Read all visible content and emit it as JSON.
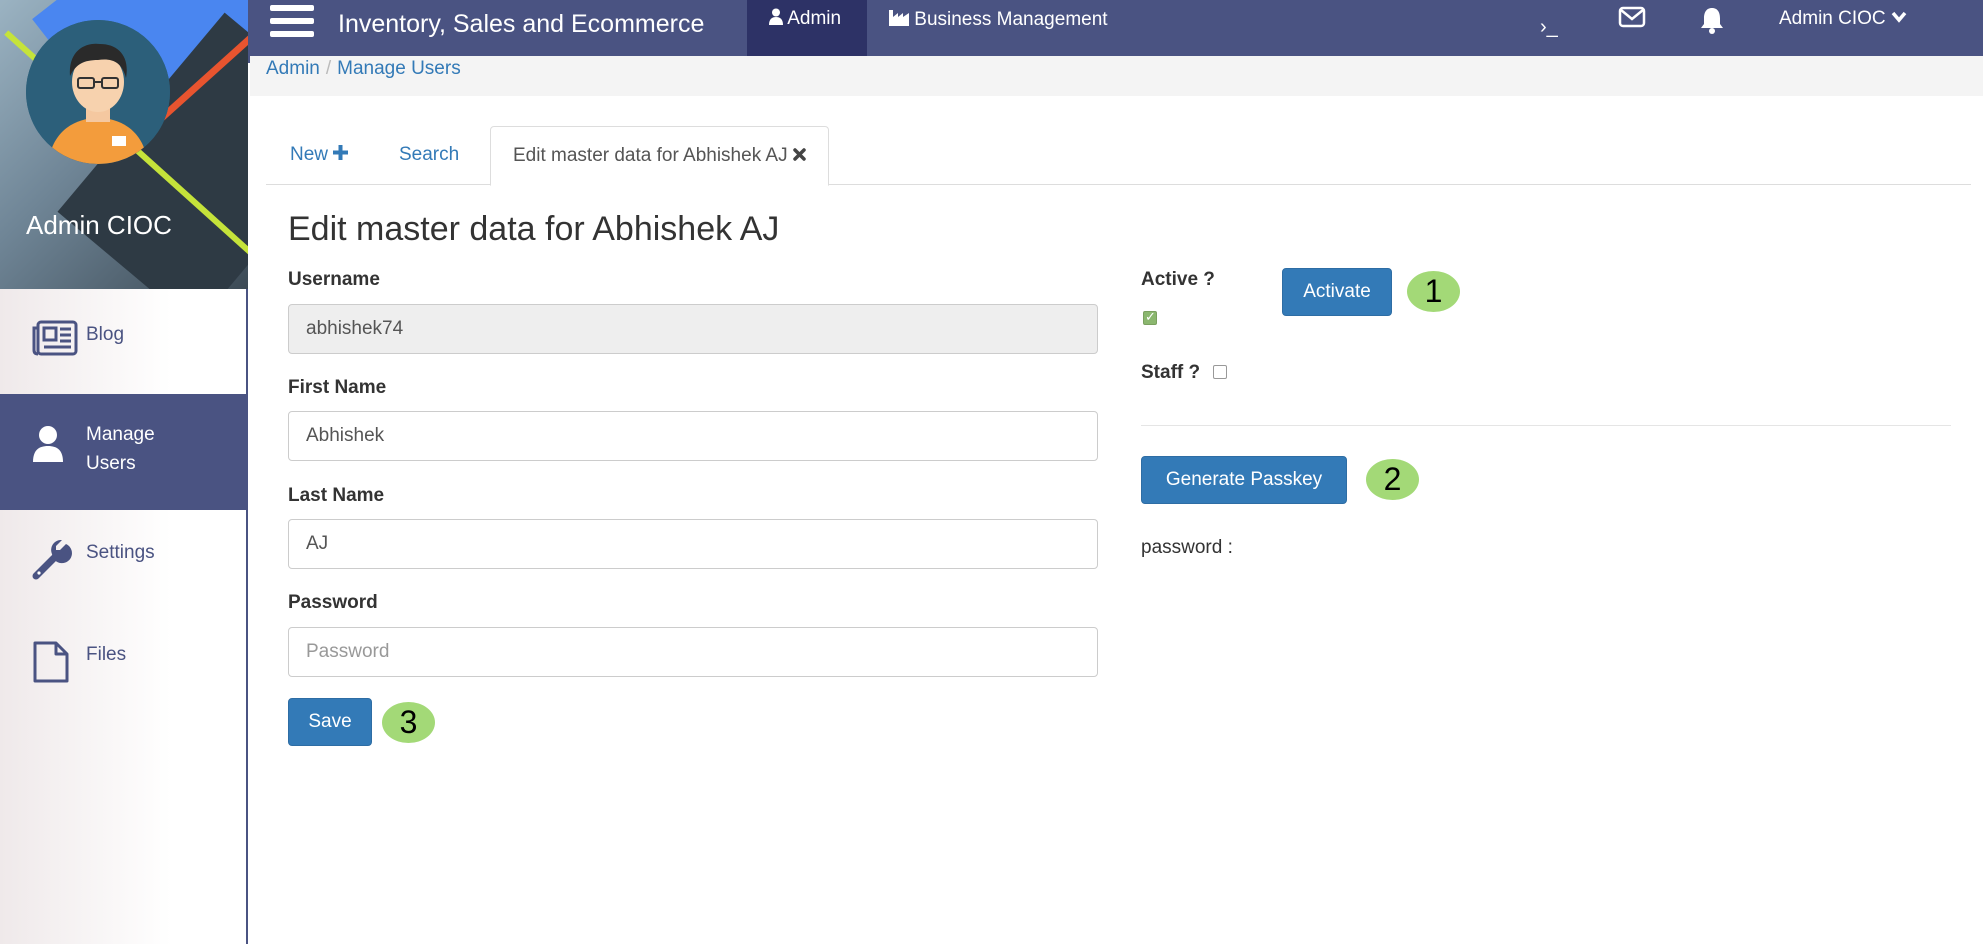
{
  "sidebar": {
    "profile_name": "Admin CIOC",
    "items": [
      {
        "label": "Blog",
        "icon": "newspaper-icon"
      },
      {
        "label": "Manage Users",
        "icon": "user-icon"
      },
      {
        "label": "Settings",
        "icon": "wrench-icon"
      },
      {
        "label": "Files",
        "icon": "file-icon"
      }
    ]
  },
  "topbar": {
    "title": "Inventory, Sales and Ecommerce",
    "tabs": [
      {
        "label": "Admin",
        "icon": "user-icon"
      },
      {
        "label": "Business Management",
        "icon": "industry-icon"
      }
    ],
    "terminal_glyph": "›_",
    "user_menu": "Admin CIOC"
  },
  "breadcrumb": [
    "Admin",
    "Manage Users"
  ],
  "tabs": [
    {
      "label": "New",
      "icon": "plus-icon"
    },
    {
      "label": "Search"
    },
    {
      "label": "Edit master data for Abhishek AJ",
      "icon": "close-icon"
    }
  ],
  "form": {
    "title": "Edit master data for Abhishek AJ",
    "username_label": "Username",
    "username_value": "abhishek74",
    "first_name_label": "First Name",
    "first_name_value": "Abhishek",
    "last_name_label": "Last Name",
    "last_name_value": "AJ",
    "password_label": "Password",
    "password_placeholder": "Password",
    "save_label": "Save",
    "active_label": "Active ?",
    "active_checked": true,
    "activate_label": "Activate",
    "staff_label": "Staff ?",
    "staff_checked": false,
    "generate_label": "Generate Passkey",
    "password_output_label": "password :"
  },
  "badges": [
    "1",
    "2",
    "3"
  ],
  "colors": {
    "nav": "#4a5382",
    "primary": "#337ab7",
    "badge": "#a3d977"
  }
}
